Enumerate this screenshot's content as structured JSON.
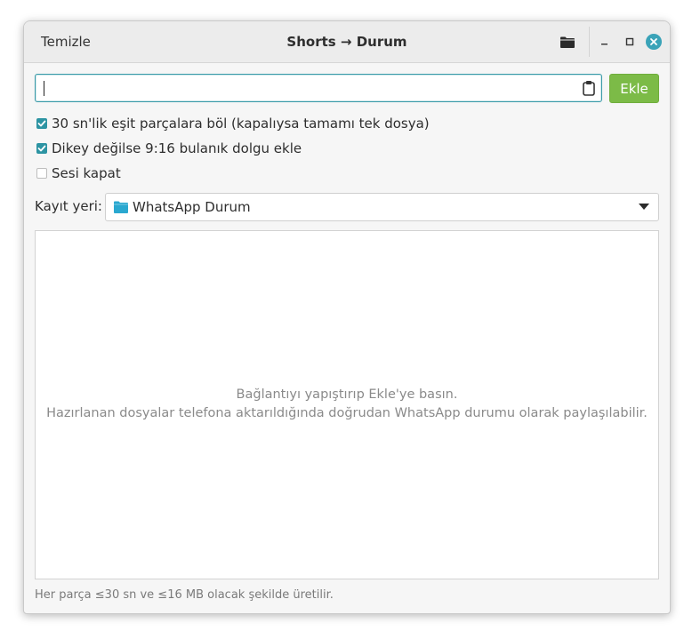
{
  "window": {
    "title": "Shorts → Durum",
    "clear_label": "Temizle"
  },
  "icons": {
    "folder": "folder-icon",
    "minimize": "minimize-icon",
    "maximize": "maximize-icon",
    "close": "close-icon",
    "paste": "clipboard-icon",
    "dropdown": "chevron-down-icon"
  },
  "url": {
    "value": "",
    "placeholder": ""
  },
  "add_button": "Ekle",
  "options": {
    "split": {
      "label": "30 sn'lik eşit parçalara böl (kapalıysa tamamı tek dosya)",
      "checked": true
    },
    "blur": {
      "label": "Dikey değilse 9:16 bulanık dolgu ekle",
      "checked": true
    },
    "mute": {
      "label": "Sesi kapat",
      "checked": false
    }
  },
  "save": {
    "label": "Kayıt yeri:",
    "selected": "WhatsApp Durum"
  },
  "empty_state": {
    "line1": "Bağlantıyı yapıştırıp Ekle'ye basın.",
    "line2": "Hazırlanan dosyalar telefona aktarıldığında doğrudan WhatsApp durumu olarak paylaşılabilir."
  },
  "footer": "Her parça ≤30 sn ve ≤16 MB olacak şekilde üretilir.",
  "colors": {
    "accent": "#2d94a3",
    "add_button": "#7cbb47",
    "close_button": "#3aa3b8"
  }
}
